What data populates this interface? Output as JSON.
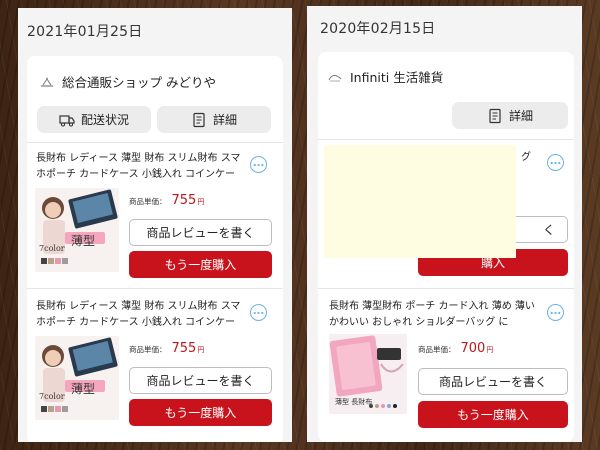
{
  "left_order": {
    "date": "2021年01月25日",
    "shop_name": "総合通販ショップ みどりや",
    "buttons": {
      "shipping": "配送状況",
      "details": "詳細"
    },
    "items": [
      {
        "title": "長財布 レディース 薄型 財布 スリム財布 スマホポーチ カードケース 小銭入れ コインケース...",
        "price_label": "商品単価：",
        "price": "755",
        "price_unit": "円",
        "thumb_text": "薄型",
        "thumb_color_label": "7color",
        "review_label": "商品レビューを書く",
        "rebuy_label": "もう一度購入"
      },
      {
        "title": "長財布 レディース 薄型 財布 スリム財布 スマホポーチ カードケース 小銭入れ コインケース...",
        "price_label": "商品単価：",
        "price": "755",
        "price_unit": "円",
        "thumb_text": "薄型",
        "thumb_color_label": "7color",
        "review_label": "商品レビューを書く",
        "rebuy_label": "もう一度購入"
      }
    ]
  },
  "right_order": {
    "date": "2020年02月15日",
    "shop_name": "Infiniti 生活雑貨",
    "buttons": {
      "details": "詳細"
    },
    "items": [
      {
        "title_visible": "グ",
        "review_label": "く",
        "rebuy_label": "購入"
      },
      {
        "title": "長財布 薄型財布 ポーチ カード入れ 薄め 薄いかわいい おしゃれ ショルダーバッグ に",
        "price_label": "商品単価：",
        "price": "700",
        "price_unit": "円",
        "thumb_text": "薄型 長財布",
        "review_label": "商品レビューを書く",
        "rebuy_label": "もう一度購入"
      }
    ]
  },
  "colors": {
    "accent_red": "#c8131c",
    "price_red": "#c0151c",
    "more_icon_blue": "#6bb3e6",
    "redaction_yellow": "#fffde1"
  },
  "icons": {
    "truck": "truck-icon",
    "details": "document-icon",
    "more": "more-horizontal-icon"
  }
}
